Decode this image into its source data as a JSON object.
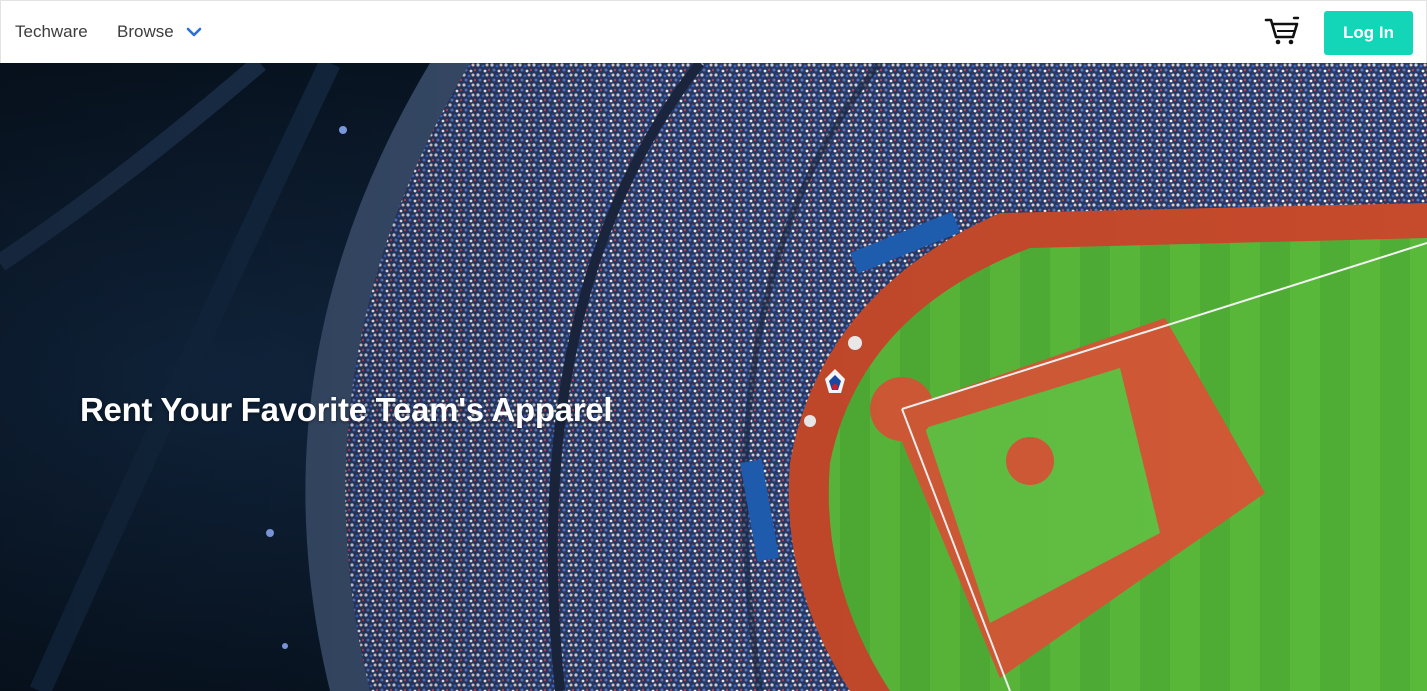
{
  "navbar": {
    "brand": "Techware",
    "browse_label": "Browse",
    "login_label": "Log In"
  },
  "icons": {
    "browse_chevron": "chevron-down-icon",
    "cart": "cart-icon"
  },
  "hero": {
    "title": "Rent Your Favorite Team's Apparel"
  },
  "colors": {
    "accent": "#13d6b8",
    "chevron": "#2a6ed6",
    "nav_text": "#3d3d3d"
  }
}
